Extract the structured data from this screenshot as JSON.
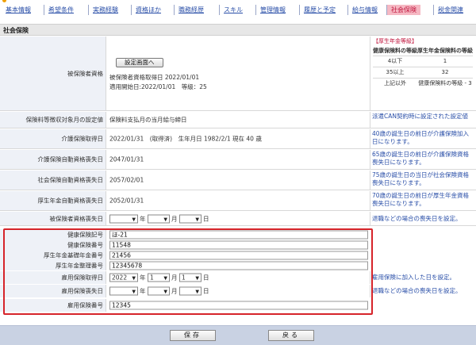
{
  "tabs": [
    {
      "label": "基本情報",
      "active": false
    },
    {
      "label": "希望条件",
      "active": false
    },
    {
      "label": "実務経験",
      "active": false
    },
    {
      "label": "資格ほか",
      "active": false
    },
    {
      "label": "職務経歴",
      "active": false
    },
    {
      "label": "スキル",
      "active": false
    },
    {
      "label": "管理情報",
      "active": false
    },
    {
      "label": "履歴と予定",
      "active": false
    },
    {
      "label": "給与情報",
      "active": false
    },
    {
      "label": "社会保険",
      "active": true
    },
    {
      "label": "税金関連",
      "active": false
    }
  ],
  "section_title": "社会保険",
  "insured": {
    "label": "被保険者資格",
    "settings_button": "設定画面へ",
    "line1": "被保険者資格取得日 2022/01/01",
    "line2": "適用開始日:2022/01/01　等級：25"
  },
  "grade_table": {
    "heading": "【厚生年金等級】",
    "col1": "健康保険料の等級",
    "col2": "厚生年金保険料の等級",
    "rows": [
      [
        "4以下",
        "1"
      ],
      [
        "35以上",
        "32"
      ],
      [
        "上記以外",
        "健康保険料の等級 - 3"
      ]
    ]
  },
  "rows": [
    {
      "name": "collection-month-row",
      "label": "保険料等徴収対象月の設定値",
      "value": "保険料支払月の当月給与締日",
      "note": "派遣CAN契約時に設定された設定値"
    },
    {
      "name": "care-insurance-acquired-row",
      "label": "介護保険取得日",
      "value": "2022/01/31　(取得済)　生年月日 1982/2/1 現在 40 歳",
      "note": "40歳の誕生日の前日が介護保険加入日になります。"
    },
    {
      "name": "care-insurance-auto-loss-row",
      "label": "介護保険自動資格喪失日",
      "value": "2047/01/31",
      "note": "65歳の誕生日の前日が介護保険資格喪失日になります。"
    },
    {
      "name": "social-insurance-auto-loss-row",
      "label": "社会保険自動資格喪失日",
      "value": "2057/02/01",
      "note": "75歳の誕生日の当日が社会保険資格喪失日になります。"
    },
    {
      "name": "pension-auto-loss-row",
      "label": "厚生年金自動資格喪失日",
      "value": "2052/01/31",
      "note": "70歳の誕生日の前日が厚生年金資格喪失日になります。"
    }
  ],
  "insured_loss": {
    "label": "被保険者資格喪失日",
    "year": "",
    "month": "",
    "day": "",
    "unit_year": "年",
    "unit_month": "月",
    "unit_day": "日",
    "note": "退職などの場合の喪失日を設定。"
  },
  "fields": [
    {
      "name": "health-insurance-symbol-input",
      "label": "健康保険記号",
      "value": "ほ-21"
    },
    {
      "name": "health-insurance-number-input",
      "label": "健康保険番号",
      "value": "11548"
    },
    {
      "name": "pension-basic-number-input",
      "label": "厚生年金基礎年金番号",
      "value": "21456"
    },
    {
      "name": "pension-reference-number-input",
      "label": "厚生年金整理番号",
      "value": "12345678"
    }
  ],
  "emp_acquired": {
    "label": "雇用保険取得日",
    "year": "2022",
    "month": "1",
    "day": "1",
    "unit_year": "年",
    "unit_month": "月",
    "unit_day": "日",
    "note": "雇用保険に加入した日を設定。"
  },
  "emp_loss": {
    "label": "雇用保険喪失日",
    "year": "",
    "month": "",
    "day": "",
    "unit_year": "年",
    "unit_month": "月",
    "unit_day": "日",
    "note": "退職などの場合の喪失日を設定。"
  },
  "emp_number": {
    "label": "雇用保険番号",
    "value": "12345"
  },
  "footer": {
    "save": "保存",
    "back": "戻る"
  },
  "colors": {
    "active_tab_bg": "#f5b8c3",
    "highlight_border": "#d6242a",
    "link": "#2a4fa8",
    "footer_bg": "#c9d2e3"
  }
}
